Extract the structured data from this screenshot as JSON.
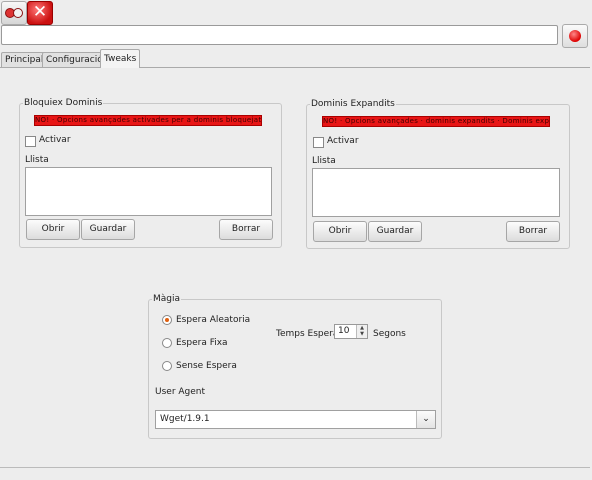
{
  "window": {
    "close_glyph": "✕"
  },
  "url_bar": {
    "value": ""
  },
  "tabs": [
    "Principal",
    "Configuració",
    "Tweaks"
  ],
  "bloquiex": {
    "title": "Bloquiex Dominis",
    "warning": "NO! · Opcions avançades activades per a dominis bloquejats · Dominis bloquejats",
    "activar": "Activar",
    "llista": "Llista",
    "buttons": {
      "obrir": "Obrir",
      "guardar": "Guardar",
      "borrar": "Borrar"
    }
  },
  "expandits": {
    "title": "Dominis Expandits",
    "warning": "NO! · Opcions avançades · dominis expandits · Dominis expandits",
    "activar": "Activar",
    "llista": "Llista",
    "buttons": {
      "obrir": "Obrir",
      "guardar": "Guardar",
      "borrar": "Borrar"
    }
  },
  "magia": {
    "title": "Màgia",
    "options": [
      "Espera Aleatoria",
      "Espera Fixa",
      "Sense Espera"
    ],
    "selected": "Espera Aleatoria",
    "temps_label": "Temps Espera",
    "temps_value": "10",
    "segons": "Segons",
    "user_agent_label": "User Agent",
    "user_agent_value": "Wget/1.9.1"
  },
  "icons": {
    "app": "app-logo-icon",
    "close": "close-icon",
    "go": "record-icon",
    "spin": "spin-arrows-icon",
    "dropdown": "chevron-down-icon"
  },
  "colors": {
    "warning_red": "#e81515",
    "radio_selected": "#e06010"
  }
}
